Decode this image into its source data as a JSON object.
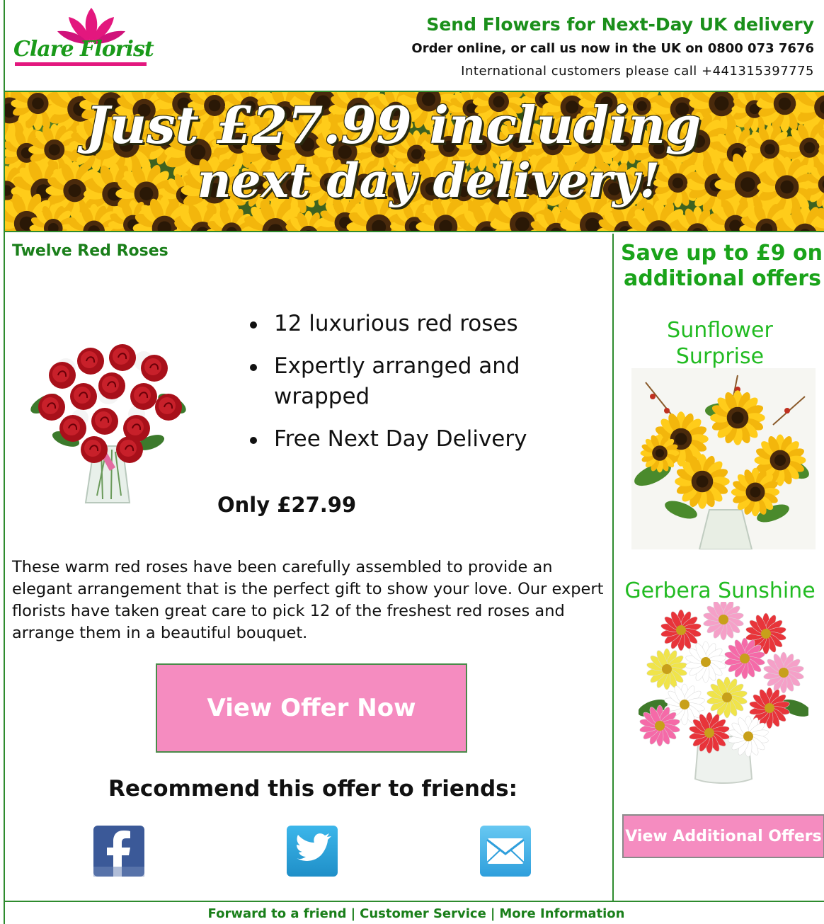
{
  "header": {
    "logo_text": "Clare Florist",
    "headline": "Send Flowers for Next-Day UK delivery",
    "order_line": "Order online, or call us now in the UK on 0800 073 7676",
    "international_line": "International customers please call +441315397775"
  },
  "banner": {
    "line1": "Just £27.99 including",
    "line2": "next day delivery!"
  },
  "product": {
    "title": "Twelve Red Roses",
    "features": [
      "12 luxurious red roses",
      "Expertly arranged and wrapped",
      "Free Next Day Delivery"
    ],
    "price": "Only £27.99",
    "description": "These warm red roses have been carefully assembled to provide an elegant arrangement that is the perfect gift to show your love. Our expert florists have taken great care to pick 12 of the freshest red roses and arrange them in a beautiful bouquet.",
    "cta_label": "View Offer Now",
    "recommend_label": "Recommend this offer to friends:",
    "social": [
      "facebook-icon",
      "twitter-icon",
      "email-icon"
    ]
  },
  "side": {
    "title_line1": "Save up to £9 on",
    "title_line2": "additional offers",
    "offers": [
      {
        "name": "Sunflower Surprise"
      },
      {
        "name": "Gerbera Sunshine"
      }
    ],
    "cta_label": "View Additional Offers"
  },
  "footer": {
    "links": [
      "Forward to a friend",
      "Customer Service",
      "More Information"
    ],
    "separator": "|"
  },
  "colors": {
    "brand_green": "#1a8f1a",
    "accent_pink": "#f58cc0",
    "logo_pink": "#e3177e"
  }
}
